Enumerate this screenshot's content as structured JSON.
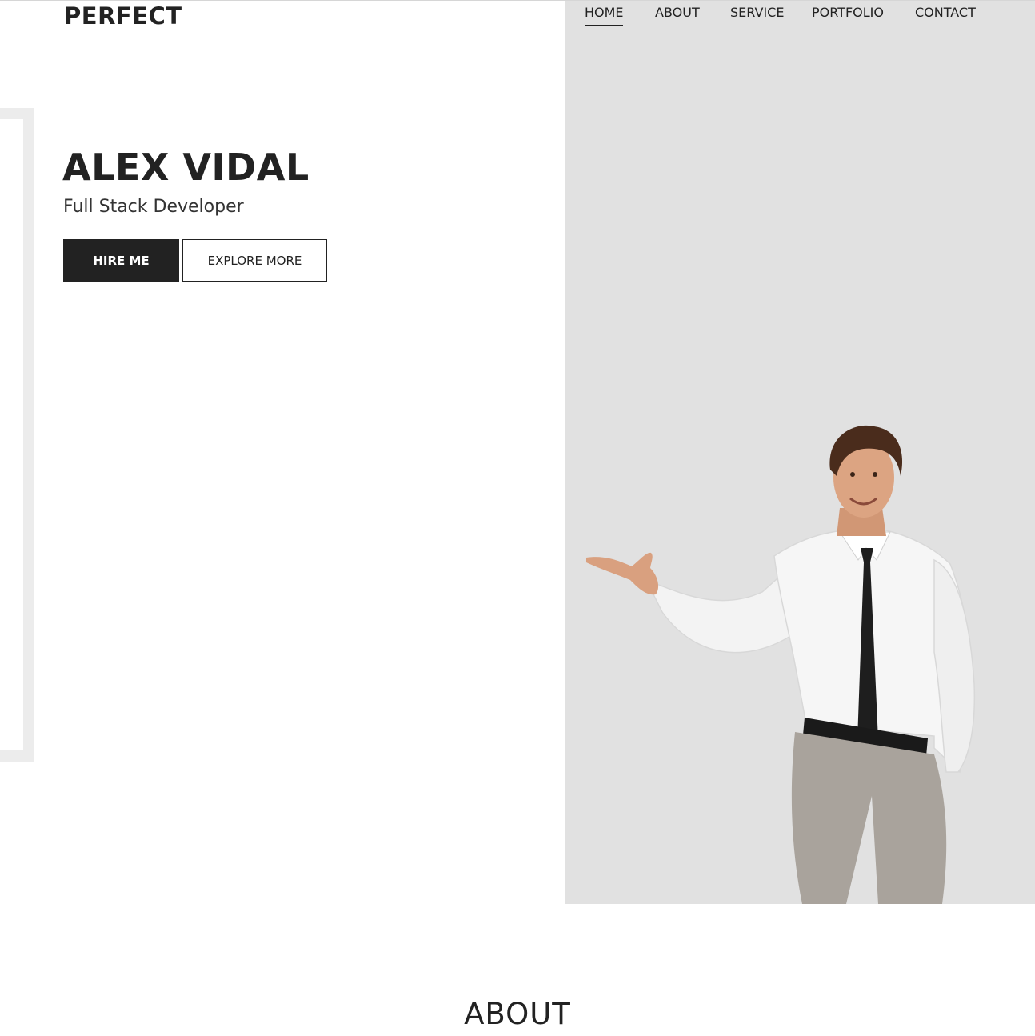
{
  "header": {
    "logo": "PERFECT",
    "nav": [
      {
        "label": "HOME",
        "active": true
      },
      {
        "label": "ABOUT",
        "active": false
      },
      {
        "label": "SERVICE",
        "active": false
      },
      {
        "label": "PORTFOLIO",
        "active": false
      },
      {
        "label": "CONTACT",
        "active": false
      }
    ]
  },
  "hero": {
    "name": "ALEX VIDAL",
    "role": "Full Stack Developer",
    "hire_label": "HIRE ME",
    "explore_label": "EXPLORE MORE",
    "image": "person-pointing-photo"
  },
  "about": {
    "title": "ABOUT"
  },
  "colors": {
    "text": "#222222",
    "panel": "#e1e1e1",
    "button_dark": "#222222",
    "frame": "#ececec"
  }
}
